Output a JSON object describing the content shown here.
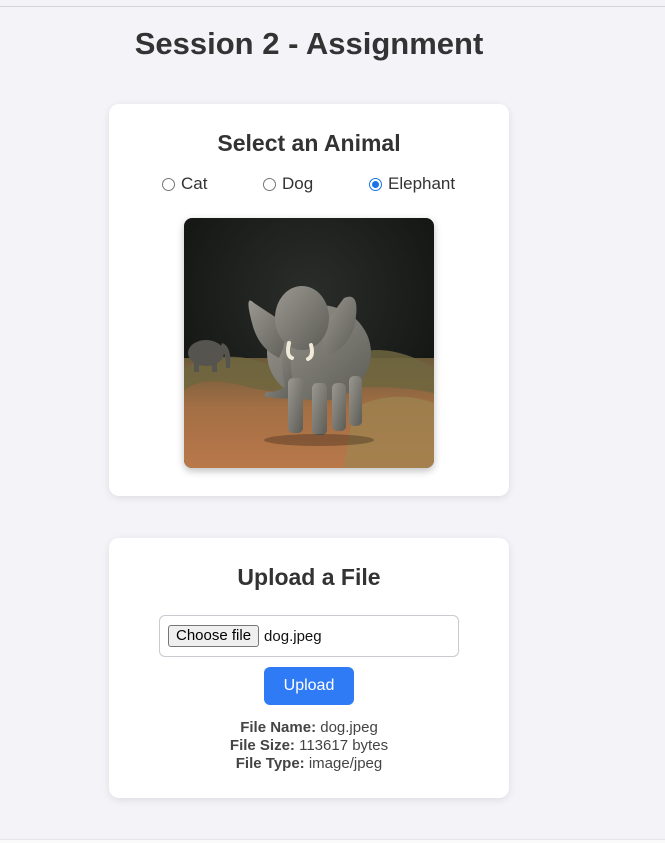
{
  "page": {
    "title": "Session 2 - Assignment"
  },
  "animal_card": {
    "heading": "Select an Animal",
    "options": [
      {
        "label": "Cat",
        "checked": false
      },
      {
        "label": "Dog",
        "checked": false
      },
      {
        "label": "Elephant",
        "checked": true
      }
    ],
    "selected": "Elephant"
  },
  "upload_card": {
    "heading": "Upload a File",
    "choose_label": "Choose file",
    "chosen_file": "dog.jpeg",
    "upload_label": "Upload",
    "info": {
      "name_label": "File Name:",
      "name_value": "dog.jpeg",
      "size_label": "File Size:",
      "size_value": "113617 bytes",
      "type_label": "File Type:",
      "type_value": "image/jpeg"
    }
  },
  "colors": {
    "accent": "#2f7bf5",
    "background": "#f3f3f8",
    "card": "#ffffff"
  }
}
